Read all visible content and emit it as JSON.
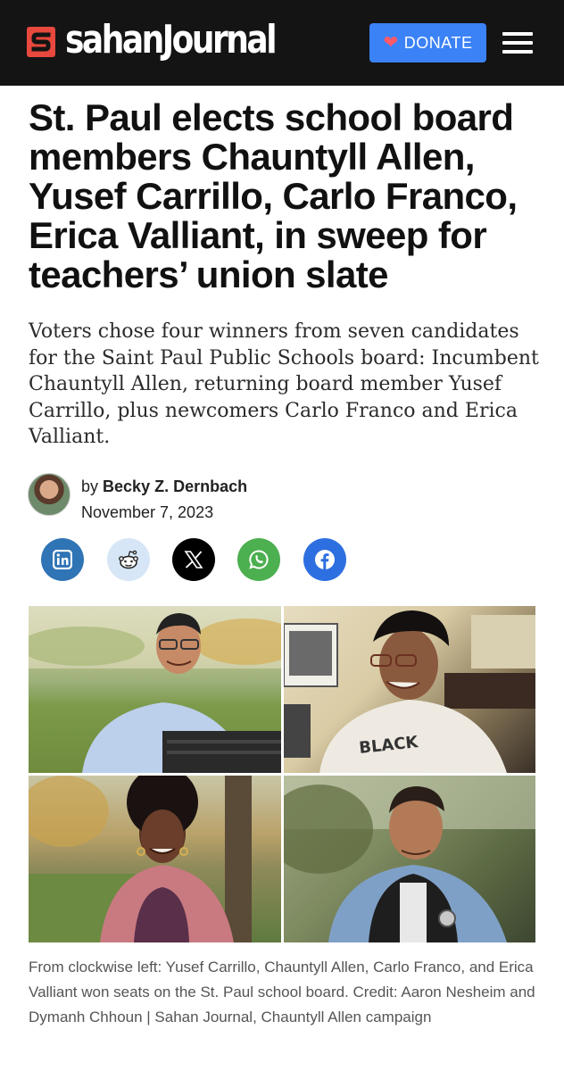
{
  "header": {
    "logo_text": "sahanJournal",
    "donate_label": "DONATE",
    "brand_red": "#e8483d",
    "donate_blue": "#3b82f6",
    "bar_color": "#141414"
  },
  "article": {
    "headline": "St. Paul elects school board members Chauntyll Allen, Yusef Carrillo, Carlo Franco, Erica Valliant, in sweep for teachers’ union slate",
    "dek": "Voters chose four winners from seven candidates for the Saint Paul Public Schools board: Incumbent Chauntyll Allen, returning board member Yusef Carrillo, plus newcomers Carlo Franco and Erica Valliant.",
    "byline_prefix": "by",
    "author": "Becky Z. Dernbach",
    "date": "November 7, 2023"
  },
  "share": [
    {
      "icon": "linkedin-icon"
    },
    {
      "icon": "reddit-icon"
    },
    {
      "icon": "x-icon"
    },
    {
      "icon": "whatsapp-icon"
    },
    {
      "icon": "facebook-icon"
    }
  ],
  "photo": {
    "caption": "From clockwise left: Yusef Carrillo, Chauntyll Allen, Carlo Franco, and Erica Valliant won seats on the St. Paul school board. Credit: Aaron Nesheim and Dymanh Chhoun | Sahan Journal, Chauntyll Allen campaign"
  }
}
